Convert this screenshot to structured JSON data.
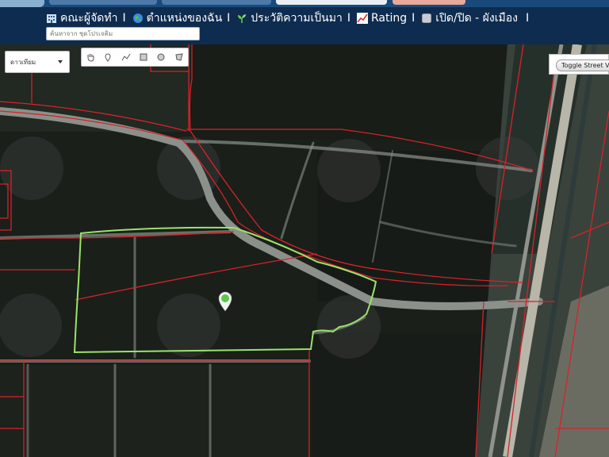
{
  "nav": {
    "items": [
      {
        "label": "คณะผู้จัดทำ",
        "icon": "building-icon"
      },
      {
        "label": "ตำแหน่งของฉัน",
        "icon": "globe-icon"
      },
      {
        "label": "ประวัติความเป็นมา",
        "icon": "sprout-icon"
      },
      {
        "label": "Rating",
        "icon": "chart-icon"
      },
      {
        "label": "เปิด/ปิด - ผังเมือง",
        "icon": "toggle-square-icon"
      }
    ],
    "separator": "I"
  },
  "search": {
    "placeholder": "ค้นหาจาก ชุดโปรเจคิม"
  },
  "map": {
    "type_selector": {
      "value": "ดาวเทียม"
    },
    "draw_tools": [
      "hand-icon",
      "marker-icon",
      "polyline-icon",
      "rectangle-icon",
      "circle-icon",
      "polygon-icon"
    ],
    "street_view_button": "Toggle Street View",
    "colors": {
      "boundary": "#d8212a",
      "selection": "#9be36a",
      "marker": "#5cc84a"
    }
  }
}
